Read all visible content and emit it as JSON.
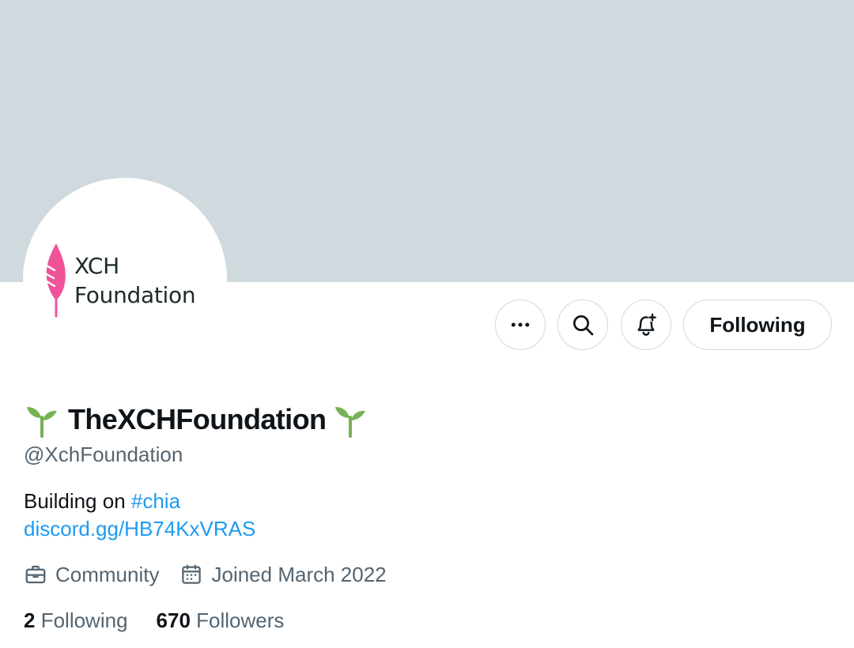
{
  "profile": {
    "logo_text_line1": "XCH",
    "logo_text_line2": "Foundation",
    "display_name": "TheXCHFoundation",
    "name_prefix_emoji": "🌱",
    "name_suffix_emoji": "🌱",
    "handle": "@XchFoundation",
    "bio_text": "Building on ",
    "bio_hashtag": "#chia",
    "link": "discord.gg/HB74KxVRAS",
    "category": "Community",
    "joined": "Joined March 2022",
    "following_count": "2",
    "following_label": "Following",
    "followers_count": "670",
    "followers_label": "Followers"
  },
  "actions": {
    "more_icon": "more-icon",
    "search_icon": "search-icon",
    "notify_icon": "bell-plus-icon",
    "follow_button_label": "Following"
  },
  "colors": {
    "banner": "#cfd9de",
    "link": "#1d9bf0",
    "secondary_text": "#536471",
    "logo_feather": "#f0539a",
    "sprout": "#77b255"
  }
}
